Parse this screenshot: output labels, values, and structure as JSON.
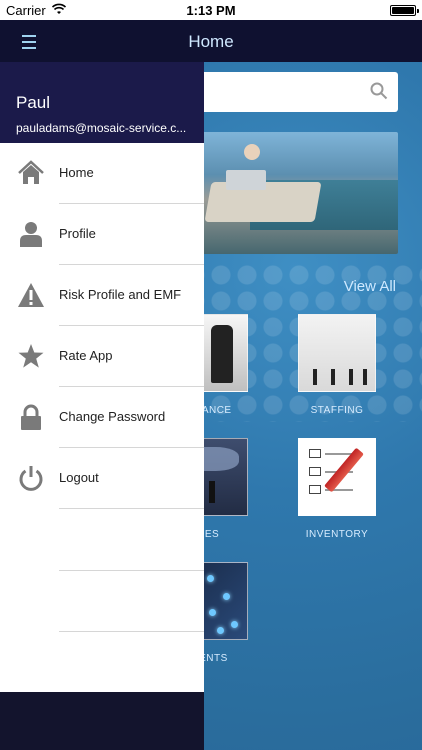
{
  "status_bar": {
    "carrier": "Carrier",
    "time": "1:13 PM"
  },
  "nav_bar": {
    "title": "Home",
    "menu_icon": "hamburger-icon"
  },
  "drawer": {
    "user_name": "Paul",
    "user_email": "pauladams@mosaic-service.c...",
    "items": [
      {
        "label": "Home",
        "icon": "home-icon"
      },
      {
        "label": "Profile",
        "icon": "person-icon"
      },
      {
        "label": "Risk Profile and EMF",
        "icon": "warning-icon"
      },
      {
        "label": "Rate App",
        "icon": "star-icon"
      },
      {
        "label": "Change Password",
        "icon": "lock-icon"
      },
      {
        "label": "Logout",
        "icon": "power-icon"
      }
    ]
  },
  "main": {
    "view_all": "View All",
    "tiles": [
      {
        "label": "RNANCE"
      },
      {
        "label": "STAFFING"
      },
      {
        "label": "LES"
      },
      {
        "label": "INVENTORY"
      },
      {
        "label": "MENTS"
      }
    ]
  },
  "colors": {
    "nav_background": "#0f1130",
    "drawer_header": "#1b1a4a",
    "main_background": "#2f78ad",
    "icon_gray": "#7a7a7a"
  }
}
